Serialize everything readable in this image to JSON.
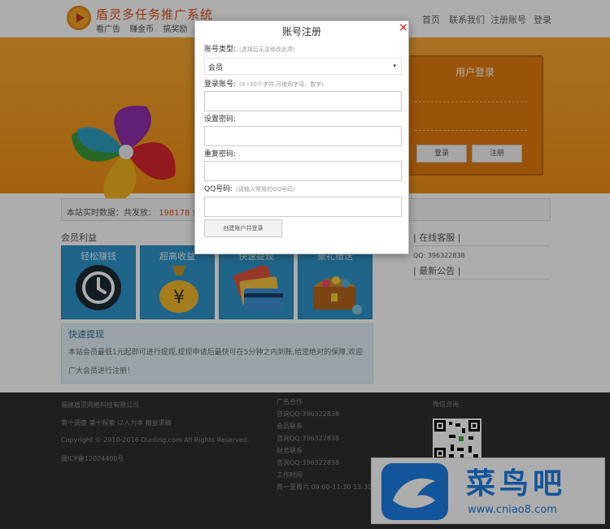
{
  "header": {
    "site_title": "盾灵多任务推广系统",
    "sub_links": [
      "看广告",
      "赚金币",
      "搞奖励"
    ],
    "nav": [
      "首页",
      "联系我们",
      "注册账号",
      "登录"
    ]
  },
  "login_box": {
    "title": "用户登录",
    "login_button": "登录",
    "register_button": "注册"
  },
  "stats": {
    "label": "本站实时数据：共发放：",
    "value": "198178",
    "unit": "金币"
  },
  "benefits": {
    "title": "会员利益",
    "tiles": [
      {
        "label": "轻松赚钱",
        "icon": "clock-icon"
      },
      {
        "label": "超高收益",
        "icon": "money-bag-icon"
      },
      {
        "label": "快速提现",
        "icon": "credit-card-icon"
      },
      {
        "label": "豪礼赠送",
        "icon": "treasure-chest-icon"
      }
    ]
  },
  "quick_withdraw": {
    "title": "快速提现",
    "body": "本站会员最低1元起即可进行提现,提现申请后最快可在5分钟之内到账,给您绝对的保障,欢迎广大会员进行注册！"
  },
  "sidebar": {
    "service_title": "| 在线客服 |",
    "qq": "QQ: 396322838",
    "notice_title": "| 最新公告 |"
  },
  "footer": {
    "company": "福建盾灵网络科技有限公司",
    "slogan": "第十调查 第十探索 以人为本 精益求精",
    "copyright": "Copyright © 2010-2016 Dunling.com All Rights Reserved.",
    "icp": "闽ICP备12024400号",
    "contact": [
      "广告合作",
      "咨询QQ:396322838",
      "会员联系",
      "咨询QQ:396322838",
      "财务联系",
      "咨询QQ:396322838",
      "工作时间",
      "周一至周六 09:00-11:30 13:30"
    ],
    "wechat_title": "微信咨询"
  },
  "watermark": {
    "brand": "菜鸟吧",
    "url": "www.cniao8.com"
  },
  "modal": {
    "title": "账号注册",
    "close": "×",
    "account_type_label": "账号类型:",
    "account_type_hint": "(选择后无法修改此项)",
    "account_type_value": "会员",
    "select_caret": "▾",
    "username_label": "登录账号:",
    "username_hint": "(3~20个字符,可使用字母、数字)",
    "password_label": "设置密码:",
    "confirm_label": "重复密码:",
    "qq_label": "QQ号码:",
    "qq_hint": "(请输入常用的QQ号码)",
    "submit": "创建账户并登录"
  },
  "colors": {
    "accent": "#f08f13",
    "title_orange": "#d9541e",
    "tile_blue": "#2f95cc",
    "footer_bg": "#2e2e2e",
    "close_red": "#ee0000",
    "watermark_blue": "#1d7ee3"
  }
}
